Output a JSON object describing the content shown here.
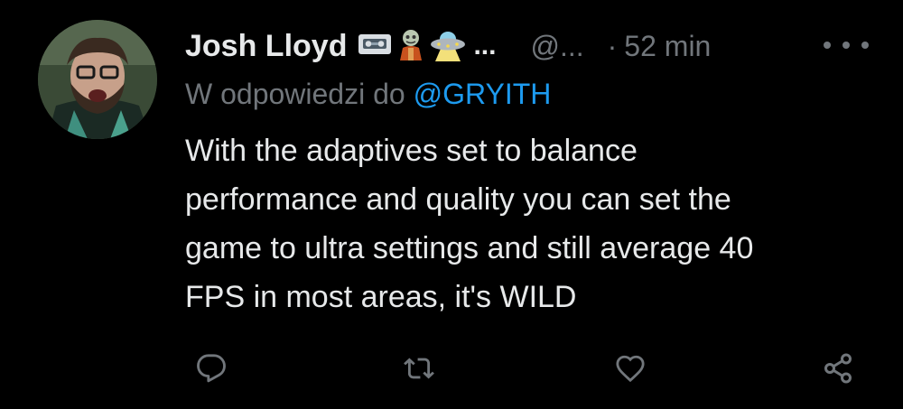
{
  "author": {
    "display_name": "Josh Lloyd",
    "badges": [
      "vhs-tape-emoji",
      "zombie-emoji",
      "ufo-emoji"
    ],
    "name_overflow": "...",
    "handle": "@...",
    "separator": "·",
    "time": "52 min"
  },
  "reply": {
    "prefix": "W odpowiedzi do",
    "mention": "@GRYITH"
  },
  "body": {
    "lines": [
      "With the adaptives set to balance",
      "performance and quality you can set the",
      "game to ultra settings and still average 40",
      "FPS in most areas, it's WILD"
    ]
  },
  "actions": {
    "icons": [
      "reply-icon",
      "retweet-icon",
      "like-icon",
      "share-icon"
    ]
  },
  "colors": {
    "background": "#000000",
    "text_primary": "#e7e9ea",
    "text_secondary": "#71767b",
    "link": "#1d9bf0"
  }
}
